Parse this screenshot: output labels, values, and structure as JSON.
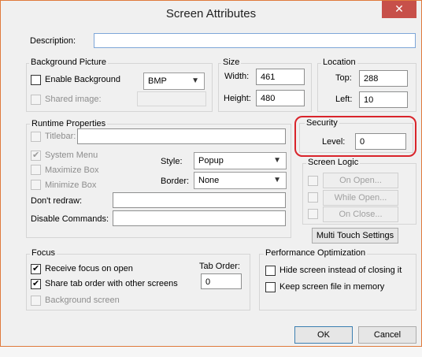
{
  "dialog": {
    "title": "Screen Attributes",
    "close_glyph": "✕"
  },
  "description": {
    "label": "Description:",
    "value": ""
  },
  "background_picture": {
    "group_label": "Background Picture",
    "enable_label": "Enable Background",
    "format_value": "BMP",
    "shared_label": "Shared image:",
    "shared_value": ""
  },
  "size": {
    "group_label": "Size",
    "width_label": "Width:",
    "width_value": "461",
    "height_label": "Height:",
    "height_value": "480"
  },
  "location": {
    "group_label": "Location",
    "top_label": "Top:",
    "top_value": "288",
    "left_label": "Left:",
    "left_value": "10"
  },
  "runtime": {
    "group_label": "Runtime Properties",
    "titlebar_label": "Titlebar:",
    "titlebar_value": "",
    "system_menu_label": "System Menu",
    "maximize_label": "Maximize Box",
    "minimize_label": "Minimize Box",
    "style_label": "Style:",
    "style_value": "Popup",
    "border_label": "Border:",
    "border_value": "None",
    "dont_redraw_label": "Don't redraw:",
    "dont_redraw_value": "",
    "disable_commands_label": "Disable Commands:",
    "disable_commands_value": ""
  },
  "security": {
    "group_label": "Security",
    "level_label": "Level:",
    "level_value": "0",
    "highlight_color": "#d9242b"
  },
  "screen_logic": {
    "group_label": "Screen Logic",
    "on_open_label": "On Open...",
    "while_open_label": "While Open...",
    "on_close_label": "On Close..."
  },
  "multi_touch_label": "Multi Touch Settings",
  "focus": {
    "group_label": "Focus",
    "receive_focus_label": "Receive focus on open",
    "share_tab_label": "Share tab order with other screens",
    "background_screen_label": "Background screen",
    "tab_order_label": "Tab Order:",
    "tab_order_value": "0"
  },
  "performance": {
    "group_label": "Performance Optimization",
    "hide_label": "Hide screen instead of closing it",
    "keep_label": "Keep screen file in memory"
  },
  "buttons": {
    "ok_label": "OK",
    "cancel_label": "Cancel"
  }
}
